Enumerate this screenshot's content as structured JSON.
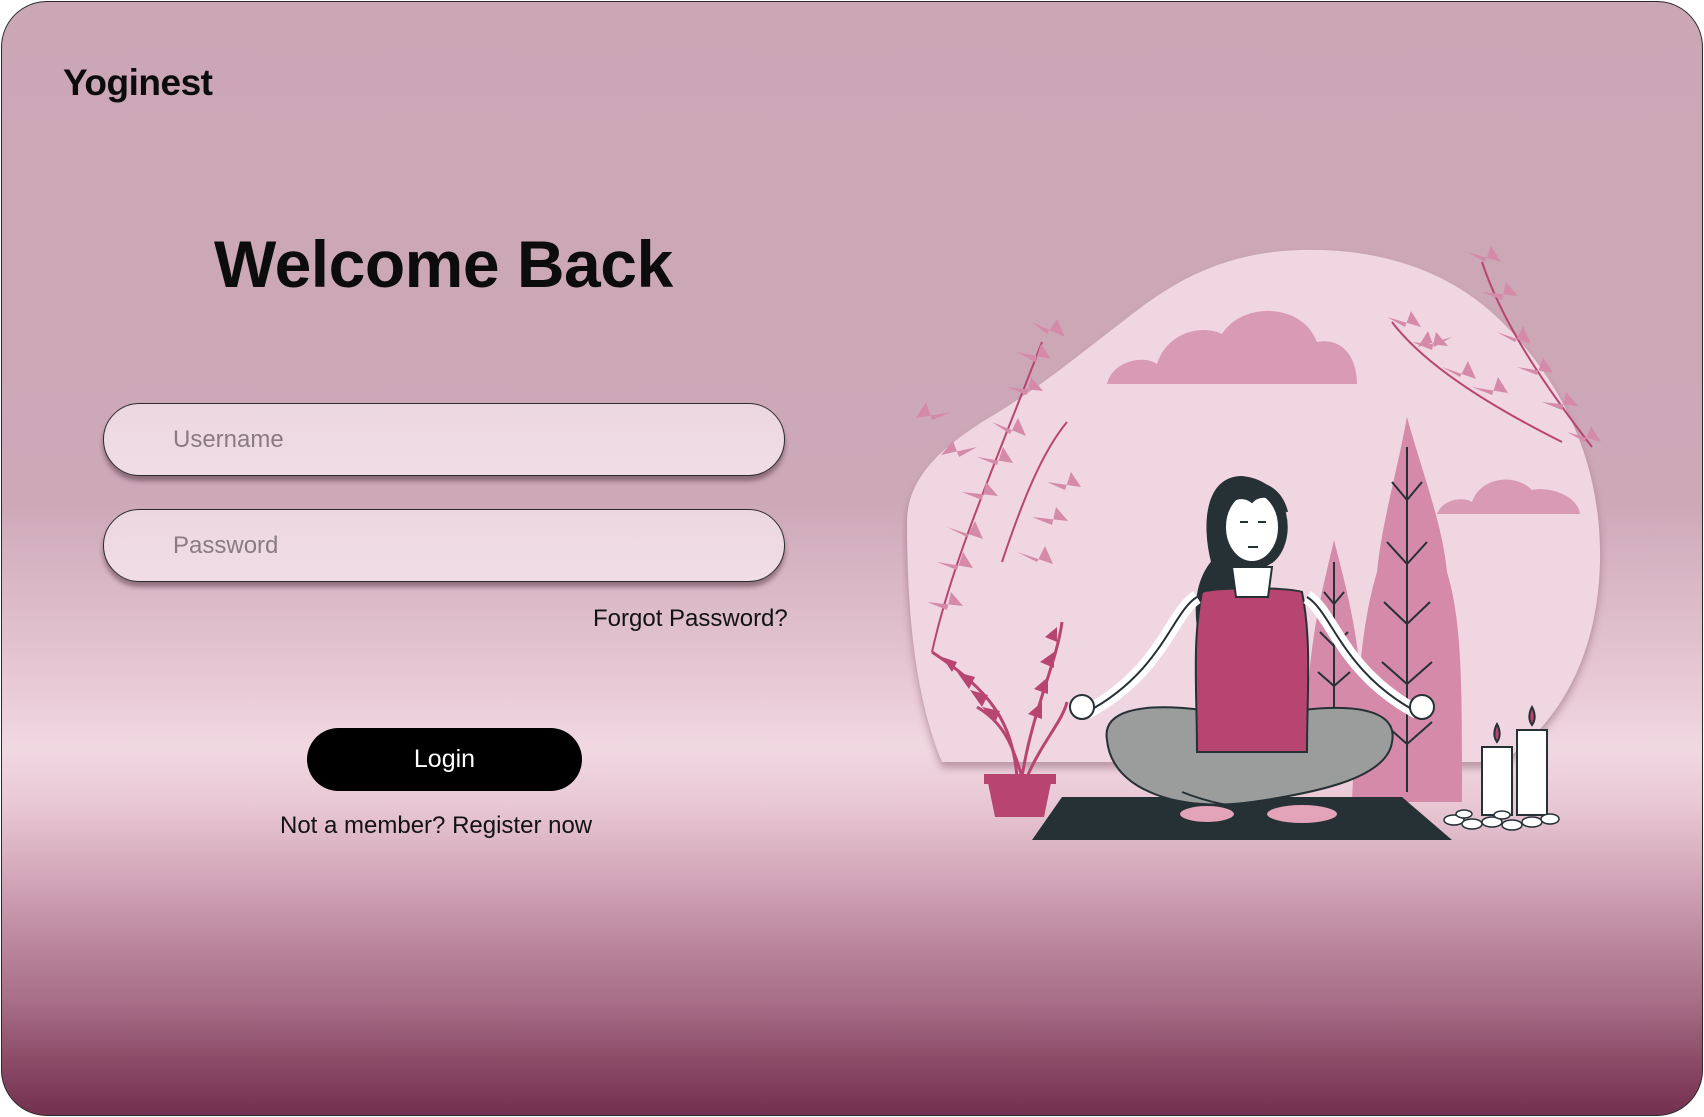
{
  "brand": {
    "logo_text": "Yoginest"
  },
  "login": {
    "title": "Welcome Back",
    "username_placeholder": "Username",
    "password_placeholder": "Password",
    "forgot_label": "Forgot Password?",
    "login_label": "Login",
    "register_label": "Not a member? Register now"
  },
  "illustration": {
    "subject": "meditating-woman-illustration"
  },
  "colors": {
    "accent": "#b8456f",
    "pale_pink": "#efd6e0",
    "dark": "#263136"
  }
}
